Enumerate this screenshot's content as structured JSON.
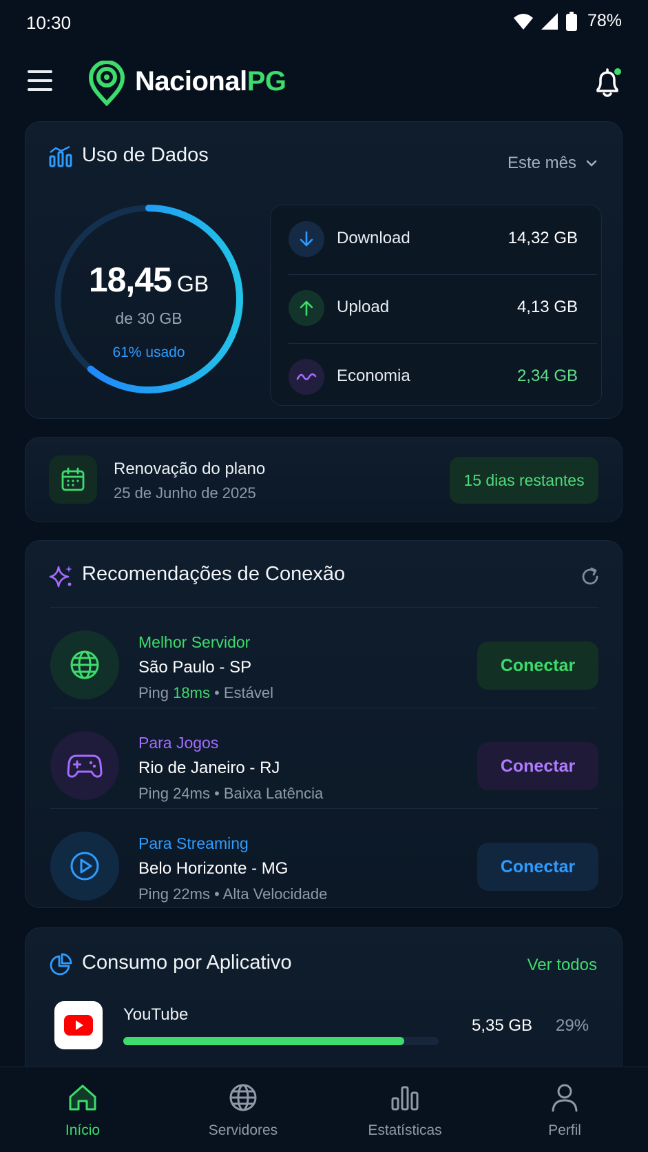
{
  "status": {
    "time": "10:30",
    "battery": "78%"
  },
  "appbar": {
    "brand_main": "Nacional",
    "brand_accent": "PG"
  },
  "usage": {
    "title": "Uso de Dados",
    "period": "Este mês",
    "used_value": "18,45",
    "used_unit": "GB",
    "total": "de 30 GB",
    "percent_label": "61% usado",
    "percent": 61,
    "stats": [
      {
        "label": "Download",
        "value": "14,32 GB"
      },
      {
        "label": "Upload",
        "value": "4,13 GB"
      },
      {
        "label": "Economia",
        "value": "2,34 GB"
      }
    ]
  },
  "renewal": {
    "title": "Renovação do plano",
    "date": "25 de Junho de 2025",
    "badge": "15 dias restantes"
  },
  "recs": {
    "title": "Recomendações de Conexão",
    "items": [
      {
        "category": "Melhor Servidor",
        "city": "São Paulo - SP",
        "ping_prefix": "Ping ",
        "ping": "18ms",
        "detail": " • Estável",
        "button": "Conectar"
      },
      {
        "category": "Para Jogos",
        "city": "Rio de Janeiro - RJ",
        "ping_prefix": "Ping ",
        "ping": "24ms",
        "detail": " • Baixa Latência",
        "button": "Conectar"
      },
      {
        "category": "Para Streaming",
        "city": "Belo Horizonte - MG",
        "ping_prefix": "Ping ",
        "ping": "22ms",
        "detail": " • Alta Velocidade",
        "button": "Conectar"
      }
    ]
  },
  "apps": {
    "title": "Consumo por Aplicativo",
    "see_all": "Ver todos",
    "items": [
      {
        "name": "YouTube",
        "size": "5,35 GB",
        "percent_label": "29%",
        "bar_fraction": 0.89
      }
    ]
  },
  "nav": [
    {
      "label": "Início"
    },
    {
      "label": "Servidores"
    },
    {
      "label": "Estatísticas"
    },
    {
      "label": "Perfil"
    }
  ],
  "colors": {
    "accent_green": "#3ddc6c",
    "accent_purple": "#a56bff",
    "accent_blue": "#2e9cff",
    "background": "#07111d"
  }
}
